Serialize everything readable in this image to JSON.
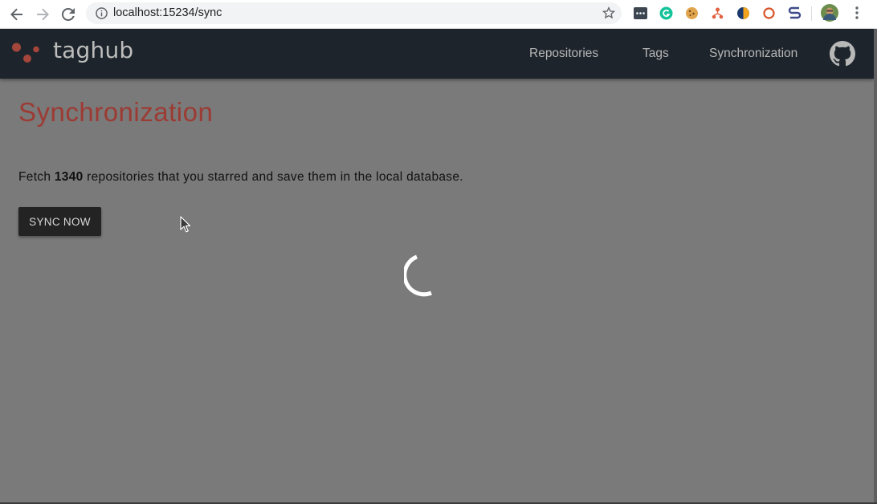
{
  "browser": {
    "url": "localhost:15234/sync",
    "back_icon": "arrow-left-icon",
    "forward_icon": "arrow-right-icon",
    "reload_icon": "reload-icon",
    "info_icon": "info-icon",
    "star_icon": "star-icon",
    "extensions": [
      "dots-extension-icon",
      "grammarly-icon",
      "cookie-icon",
      "network-extension-icon",
      "half-circle-extension-icon",
      "ring-extension-icon",
      "s-extension-icon"
    ],
    "avatar_icon": "profile-avatar-icon",
    "menu_icon": "kebab-menu-icon"
  },
  "app": {
    "brand": "taghub",
    "nav": {
      "repositories": "Repositories",
      "tags": "Tags",
      "synchronization": "Synchronization"
    },
    "github_icon": "github-icon"
  },
  "page": {
    "title": "Synchronization",
    "desc_prefix": "Fetch ",
    "repo_count": "1340",
    "desc_suffix": " repositories that you starred and save them in the local database.",
    "sync_button": "SYNC NOW"
  },
  "colors": {
    "header_bg": "#1d242b",
    "overlay": "#7a7a7a",
    "title": "#9c3b33",
    "logo_dot": "#a4463b"
  }
}
